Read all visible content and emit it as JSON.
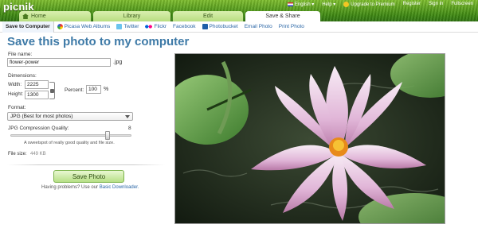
{
  "app": {
    "logo": "picnik"
  },
  "toplinks": {
    "language": "English ▾",
    "help": "Help ▾",
    "premium": "Upgrade to Premium",
    "register": "Register",
    "signin": "Sign in",
    "fullscreen": "Fullscreen"
  },
  "tabs": [
    "Home",
    "Library",
    "Edit",
    "Save & Share"
  ],
  "subtabs": [
    "Save to Computer",
    "Picasa Web Albums",
    "Twitter",
    "Flickr",
    "Facebook",
    "Photobucket",
    "Email Photo",
    "Print Photo"
  ],
  "form": {
    "title": "Save this photo to my computer",
    "file_name_label": "File name:",
    "file_name_value": "flower-power",
    "extension": ".jpg",
    "dimensions_label": "Dimensions:",
    "width_label": "Width:",
    "width_value": "2225",
    "height_label": "Height:",
    "height_value": "1300",
    "percent_label": "Percent:",
    "percent_value": "100",
    "percent_symbol": "%",
    "format_label": "Format:",
    "format_value": "JPG (Best for most photos)",
    "quality_label": "JPG Compression Quality:",
    "quality_value": "8",
    "quality_level": 0.8,
    "quality_hint": "A sweetspot of really good quality and file size.",
    "file_size_label": "File size:",
    "file_size_value": "449 KB",
    "save_button": "Save Photo",
    "help_text": "Having problems? Use our",
    "help_link": "Basic Downloader."
  },
  "colors": {
    "title": "#3e7aa7",
    "link": "#2a66a6",
    "grass": "#3f8a12"
  }
}
